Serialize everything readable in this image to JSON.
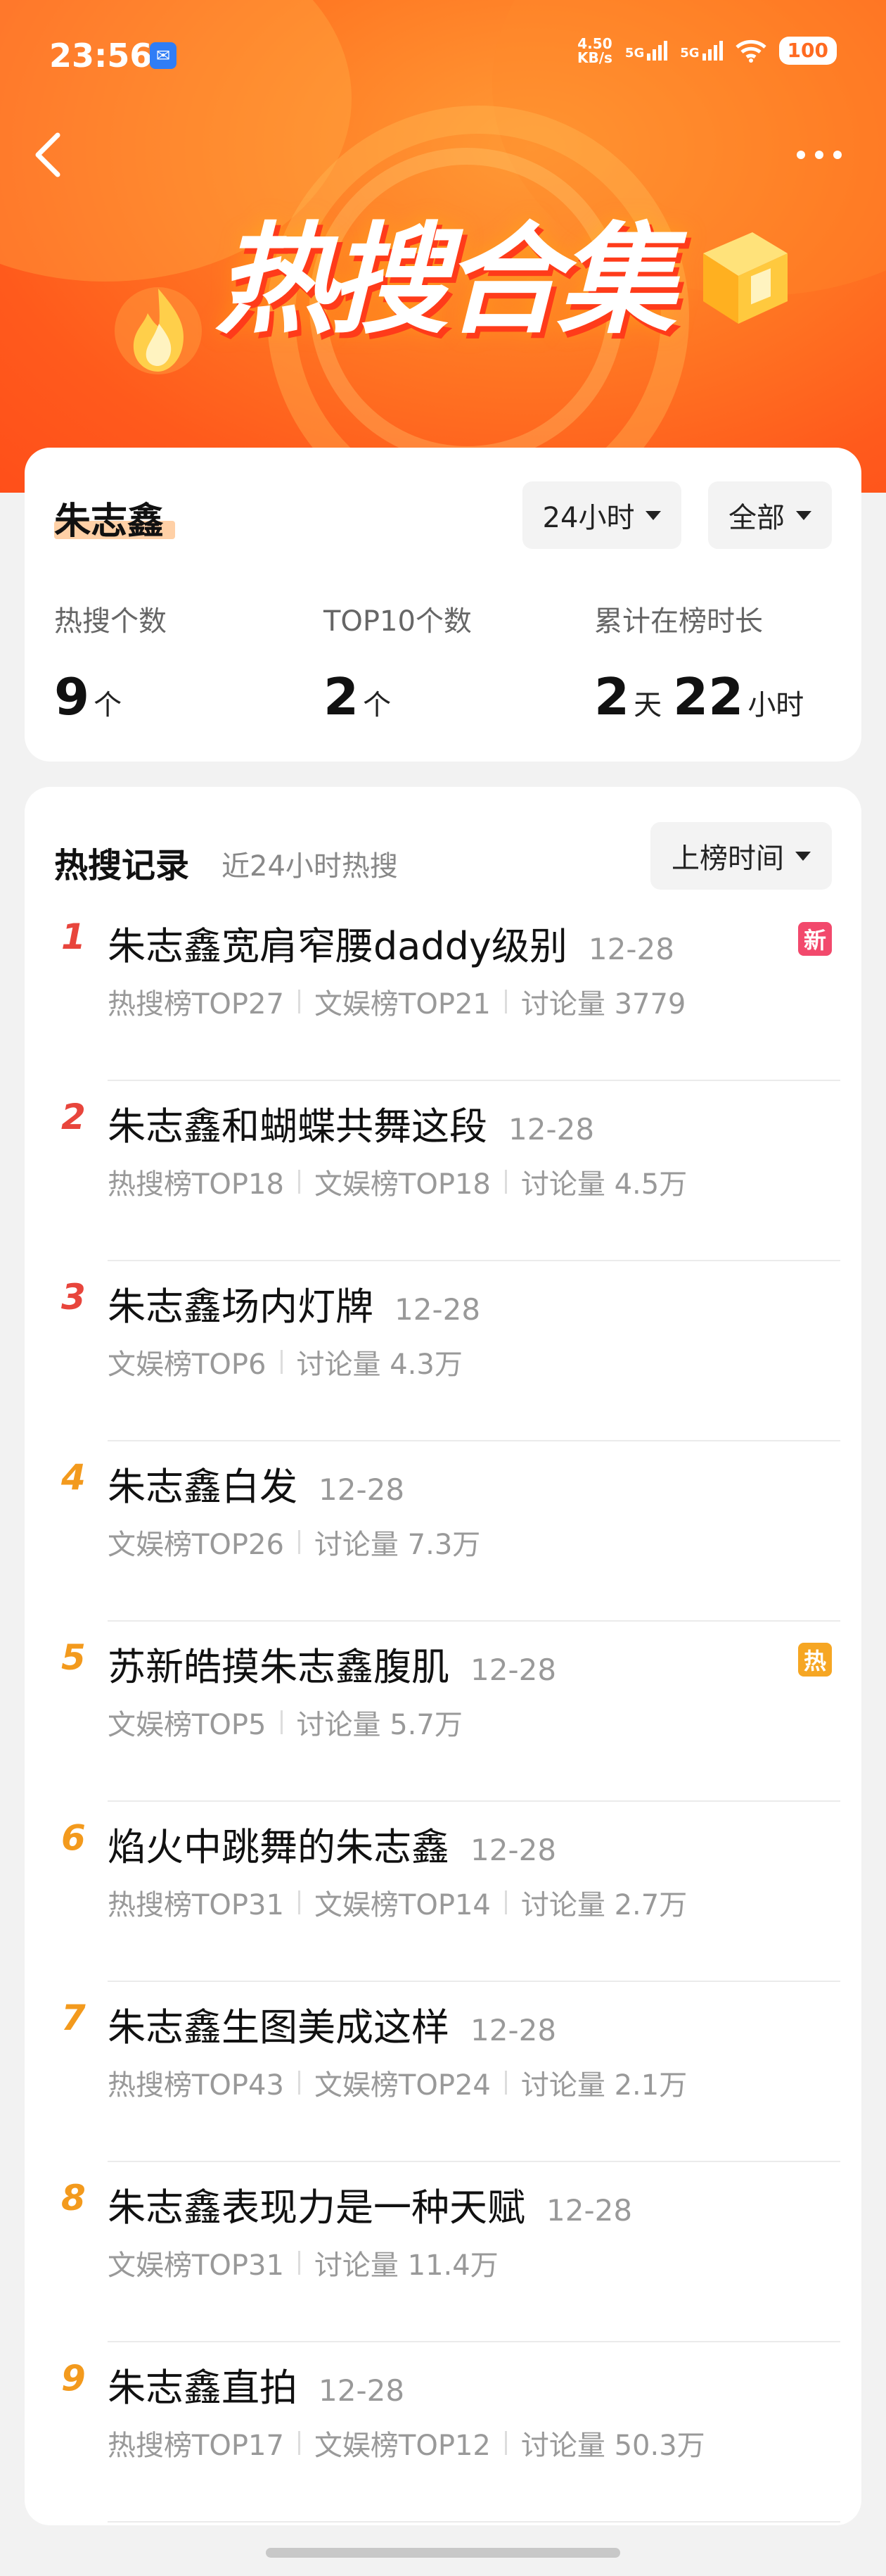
{
  "status_bar": {
    "time": "23:56",
    "net_speed_value": "4.50",
    "net_speed_unit": "KB/s",
    "signal_1": "5G",
    "signal_2": "5G",
    "battery": "100"
  },
  "header": {
    "title": "热搜合集"
  },
  "summary": {
    "name": "朱志鑫",
    "time_filter": "24小时",
    "category_filter": "全部",
    "stats": [
      {
        "label": "热搜个数",
        "value": "9",
        "unit": "个"
      },
      {
        "label": "TOP10个数",
        "value": "2",
        "unit": "个"
      },
      {
        "label": "累计在榜时长",
        "days": "2",
        "days_unit": "天",
        "hours": "22",
        "hours_unit": "小时"
      }
    ]
  },
  "records": {
    "title": "热搜记录",
    "subtitle": "近24小时热搜",
    "sort_label": "上榜时间",
    "colors": {
      "top_rank": "#e8453c",
      "other_rank": "#f39a1d",
      "badge_new": "#f2496c",
      "badge_hot": "#f6a623"
    },
    "items": [
      {
        "rank": "1",
        "title": "朱志鑫宽肩窄腰daddy级别",
        "date": "12-28",
        "meta": [
          "热搜榜TOP27",
          "文娱榜TOP21",
          "讨论量 3779"
        ],
        "badge": "新"
      },
      {
        "rank": "2",
        "title": "朱志鑫和蝴蝶共舞这段",
        "date": "12-28",
        "meta": [
          "热搜榜TOP18",
          "文娱榜TOP18",
          "讨论量 4.5万"
        ],
        "badge": ""
      },
      {
        "rank": "3",
        "title": "朱志鑫场内灯牌",
        "date": "12-28",
        "meta": [
          "文娱榜TOP6",
          "讨论量 4.3万"
        ],
        "badge": ""
      },
      {
        "rank": "4",
        "title": "朱志鑫白发",
        "date": "12-28",
        "meta": [
          "文娱榜TOP26",
          "讨论量 7.3万"
        ],
        "badge": ""
      },
      {
        "rank": "5",
        "title": "苏新皓摸朱志鑫腹肌",
        "date": "12-28",
        "meta": [
          "文娱榜TOP5",
          "讨论量 5.7万"
        ],
        "badge": "热"
      },
      {
        "rank": "6",
        "title": "焰火中跳舞的朱志鑫",
        "date": "12-28",
        "meta": [
          "热搜榜TOP31",
          "文娱榜TOP14",
          "讨论量 2.7万"
        ],
        "badge": ""
      },
      {
        "rank": "7",
        "title": "朱志鑫生图美成这样",
        "date": "12-28",
        "meta": [
          "热搜榜TOP43",
          "文娱榜TOP24",
          "讨论量 2.1万"
        ],
        "badge": ""
      },
      {
        "rank": "8",
        "title": "朱志鑫表现力是一种天赋",
        "date": "12-28",
        "meta": [
          "文娱榜TOP31",
          "讨论量 11.4万"
        ],
        "badge": ""
      },
      {
        "rank": "9",
        "title": "朱志鑫直拍",
        "date": "12-28",
        "meta": [
          "热搜榜TOP17",
          "文娱榜TOP12",
          "讨论量 50.3万"
        ],
        "badge": ""
      }
    ]
  }
}
